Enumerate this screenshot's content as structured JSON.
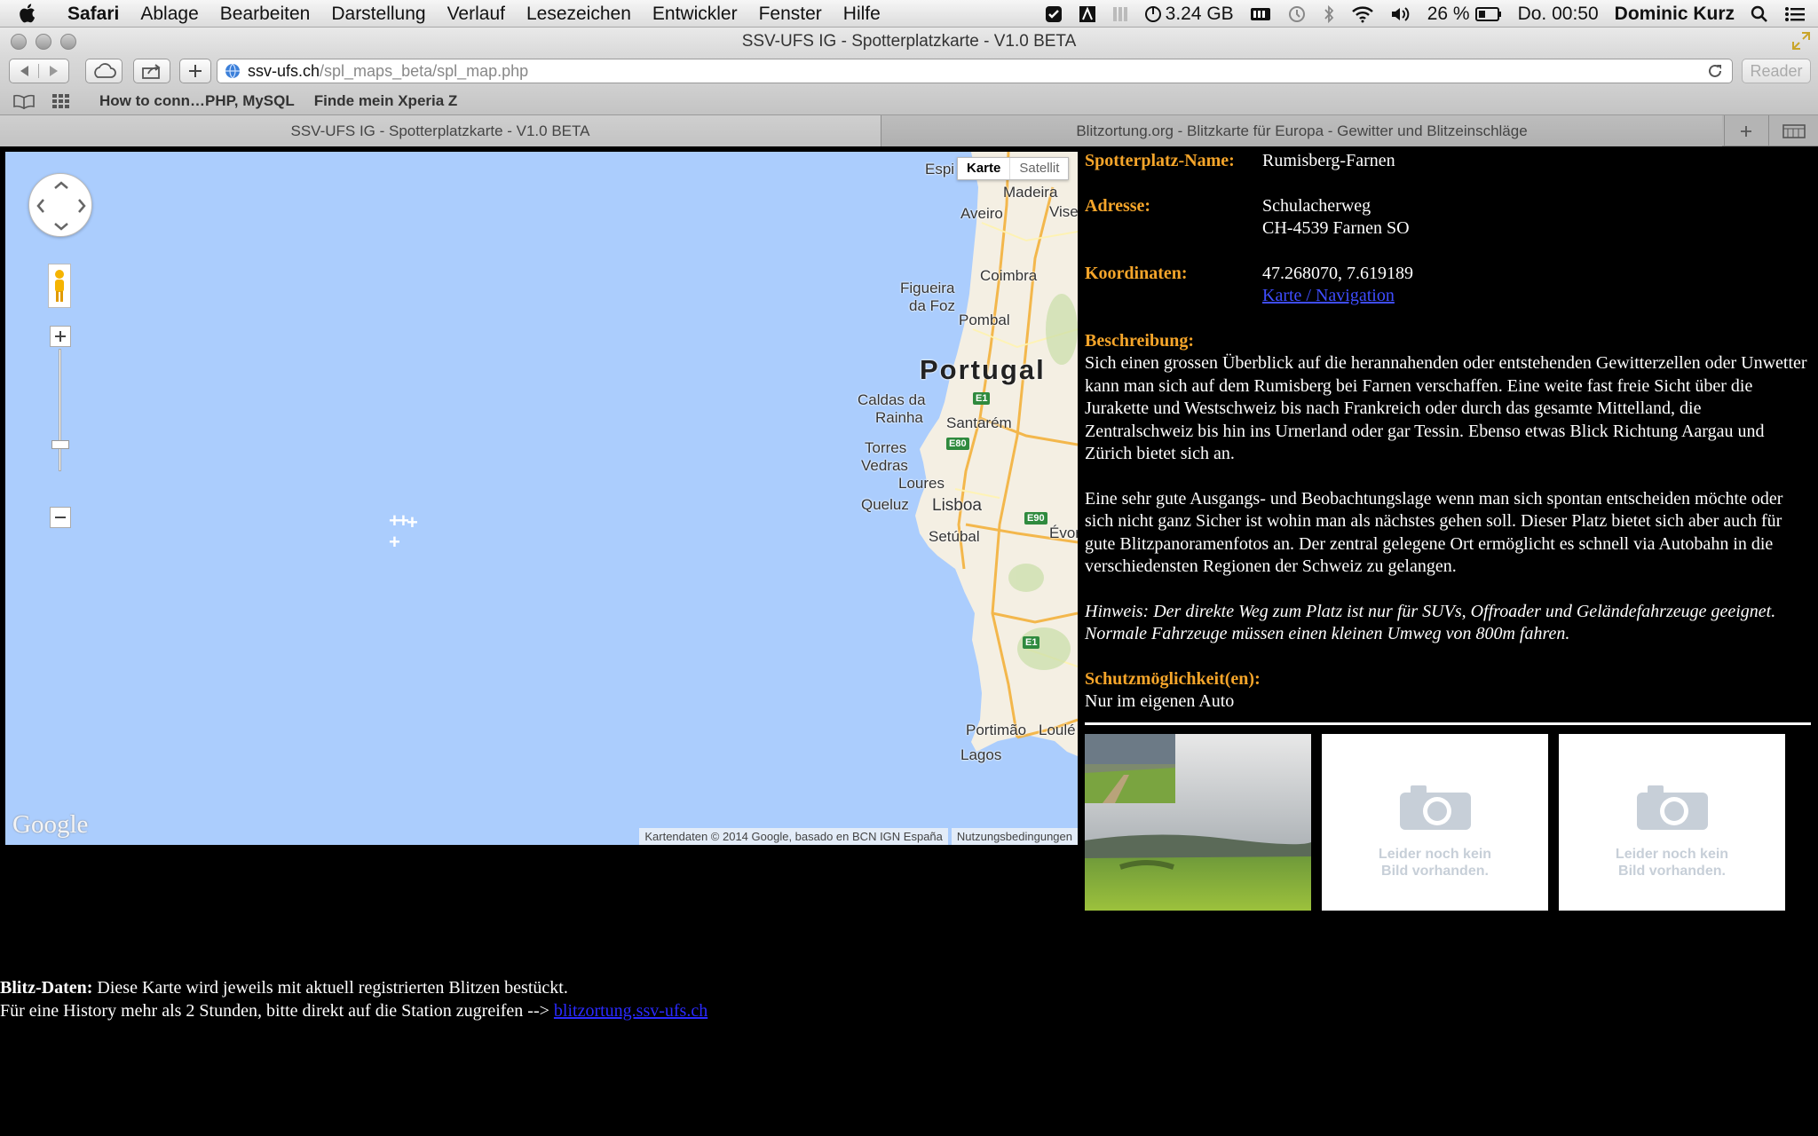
{
  "menubar": {
    "app": "Safari",
    "items": [
      "Ablage",
      "Bearbeiten",
      "Darstellung",
      "Verlauf",
      "Lesezeichen",
      "Entwickler",
      "Fenster",
      "Hilfe"
    ],
    "memory": "3.24 GB",
    "battery": "26 %",
    "clock": "Do. 00:50",
    "user": "Dominic Kurz"
  },
  "window": {
    "title": "SSV-UFS IG - Spotterplatzkarte - V1.0 BETA"
  },
  "toolbar": {
    "url_host": "ssv-ufs.ch",
    "url_path": "/spl_maps_beta/spl_map.php",
    "reader_label": "Reader"
  },
  "bookmarks": [
    "How to conn…PHP, MySQL",
    "Finde mein Xperia Z"
  ],
  "tabs": [
    {
      "label": "SSV-UFS IG - Spotterplatzkarte - V1.0 BETA"
    },
    {
      "label": "Blitzortung.org - Blitzkarte für Europa - Gewitter und Blitzeinschläge"
    }
  ],
  "map": {
    "type_buttons": [
      "Karte",
      "Satellit"
    ],
    "labels": {
      "espi": "Espi",
      "madeira": "Madeira",
      "aveiro": "Aveiro",
      "vise": "Vise",
      "coimbra": "Coimbra",
      "figueira": "Figueira",
      "dafoz": "da Foz",
      "pombal": "Pombal",
      "portugal": "Portugal",
      "caldas": "Caldas da",
      "rainha": "Rainha",
      "santarem": "Santarém",
      "torres": "Torres",
      "vedras": "Vedras",
      "loures": "Loures",
      "queluz": "Queluz",
      "lisboa": "Lisboa",
      "evor": "Évor",
      "setubal": "Setúbal",
      "portimao": "Portimão",
      "loule": "Loulé",
      "lagos": "Lagos"
    },
    "roads": [
      "E1",
      "E80",
      "E90",
      "E1"
    ],
    "logo": "Google",
    "copyright": "Kartendaten © 2014 Google, basado en BCN IGN España",
    "terms": "Nutzungsbedingungen"
  },
  "info": {
    "name_label": "Spotterplatz-Name:",
    "name": "Rumisberg-Farnen",
    "address_label": "Adresse:",
    "address_line1": "Schulacherweg",
    "address_line2": "CH-4539 Farnen SO",
    "coords_label": "Koordinaten:",
    "coords": "47.268070, 7.619189",
    "nav_link": "Karte / Navigation",
    "desc_label": "Beschreibung:",
    "desc_p1": "Sich einen grossen Überblick auf die herannahenden oder entstehenden Gewitterzellen oder Unwetter kann man sich auf dem Rumisberg bei Farnen verschaffen. Eine weite fast freie Sicht über die Jurakette und Westschweiz bis nach Frankreich oder durch das gesamte Mittelland, die Zentralschweiz bis hin ins Urnerland oder gar Tessin. Ebenso etwas Blick Richtung Aargau und Zürich bietet sich an.",
    "desc_p2": "Eine sehr gute Ausgangs- und Beobachtungslage wenn man sich spontan entscheiden möchte oder sich nicht ganz Sicher ist wohin man als nächstes gehen soll. Dieser Platz bietet sich aber auch für gute Blitzpanoramenfotos an. Der zentral gelegene Ort ermöglicht es schnell via Autobahn in die verschiedensten Regionen der Schweiz zu gelangen.",
    "hint": "Hinweis: Der direkte Weg zum Platz ist nur für SUVs, Offroader und Geländefahrzeuge geeignet. Normale Fahrzeuge müssen einen kleinen Umweg von 800m fahren.",
    "protection_label": "Schutzmöglichkeit(en):",
    "protection": "Nur im eigenen Auto",
    "no_image_line1": "Leider noch kein",
    "no_image_line2": "Bild vorhanden."
  },
  "blitz": {
    "label": "Blitz-Daten:",
    "text1": " Diese Karte wird jeweils mit aktuell registrierten Blitzen bestückt.",
    "text2": "Für eine History mehr als 2 Stunden, bitte direkt auf die Station zugreifen --> ",
    "link": "blitzortung.ssv-ufs.ch"
  },
  "colors": {
    "label_orange": "#f5a52a",
    "link_blue": "#3f4dff",
    "ocean": "#abcdfd"
  }
}
